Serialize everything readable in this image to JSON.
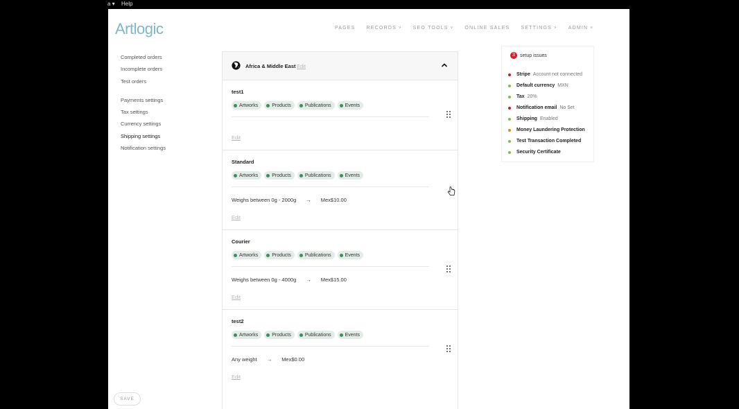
{
  "system_menu": {
    "app_menu": "a ▾",
    "help": "Help"
  },
  "brand": {
    "logo": "Artlogic",
    "logo_color": "#7fb6c9"
  },
  "nav": [
    {
      "label": "PAGES",
      "dropdown": false
    },
    {
      "label": "RECORDS",
      "dropdown": true
    },
    {
      "label": "SEO TOOLS",
      "dropdown": true
    },
    {
      "label": "ONLINE SALES",
      "dropdown": false
    },
    {
      "label": "SETTINGS",
      "dropdown": true
    },
    {
      "label": "ADMIN",
      "dropdown": true
    }
  ],
  "sidebar": {
    "group1": [
      "Completed orders",
      "Incomplete orders",
      "Test orders"
    ],
    "group2": [
      "Payments settings",
      "Tax settings",
      "Currency settings",
      "Shipping settings",
      "Notification settings"
    ],
    "active": "Shipping settings"
  },
  "region": {
    "name": "Africa & Middle East",
    "edit": "Edit",
    "icon": "globe-icon"
  },
  "rules": [
    {
      "title": "test1",
      "tags": [
        "Artworks",
        "Products",
        "Publications",
        "Events"
      ],
      "weight": "",
      "arrow": "",
      "price": "",
      "edit": "Edit"
    },
    {
      "title": "Standard",
      "tags": [
        "Artworks",
        "Products",
        "Publications",
        "Events"
      ],
      "weight": "Weighs between 0g - 2000g",
      "arrow": "→",
      "price": "Mex$10.00",
      "edit": "Edit"
    },
    {
      "title": "Courier",
      "tags": [
        "Artworks",
        "Products",
        "Publications",
        "Events"
      ],
      "weight": "Weighs between 0g - 4000g",
      "arrow": "→",
      "price": "Mex$15.00",
      "edit": "Edit"
    },
    {
      "title": "test2",
      "tags": [
        "Artworks",
        "Products",
        "Publications",
        "Events"
      ],
      "weight": "Any weight",
      "arrow": "→",
      "price": "Mex$0.00",
      "edit": "Edit"
    }
  ],
  "setup": {
    "count": "3",
    "title": "setup issues",
    "items": [
      {
        "label": "Stripe",
        "value": "Account not connected",
        "status_color": "#c0202a"
      },
      {
        "label": "Default currency",
        "value": "MXN",
        "status_color": "#7fbf4d"
      },
      {
        "label": "Tax",
        "value": "20%",
        "status_color": "#7fbf4d"
      },
      {
        "label": "Notification email",
        "value": "No Set",
        "status_color": "#c0202a"
      },
      {
        "label": "Shipping",
        "value": "Enabled",
        "status_color": "#7fbf4d"
      },
      {
        "label": "Money Laundering Protection",
        "value": "",
        "status_color": "#e08a1e"
      },
      {
        "label": "Test Transaction Completed",
        "value": "",
        "status_color": "#7fbf4d"
      },
      {
        "label": "Security Certificate",
        "value": "",
        "status_color": "#7fbf4d"
      }
    ]
  },
  "save_label": "SAVE"
}
